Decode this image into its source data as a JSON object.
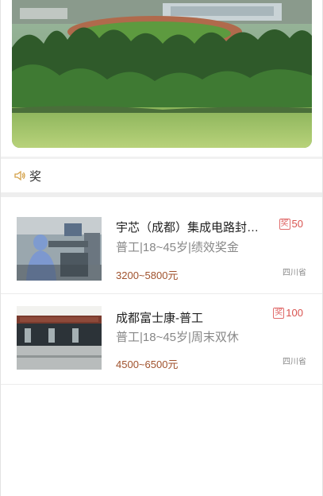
{
  "notice": {
    "icon": "speaker-icon",
    "text": "奖"
  },
  "jobs": [
    {
      "title": "宇芯（成都）集成电路封…",
      "tags": "普工|18~45岁|绩效奖金",
      "salary": "3200~5800元",
      "reward_badge": "奖",
      "reward": "50",
      "location": "四川省"
    },
    {
      "title": "成都富士康-普工",
      "tags": "普工|18~45岁|周末双休",
      "salary": "4500~6500元",
      "reward_badge": "奖",
      "reward": "100",
      "location": "四川省"
    }
  ],
  "colors": {
    "salary": "#a0522d",
    "reward": "#d9534f",
    "separator": "#eeeeee"
  }
}
